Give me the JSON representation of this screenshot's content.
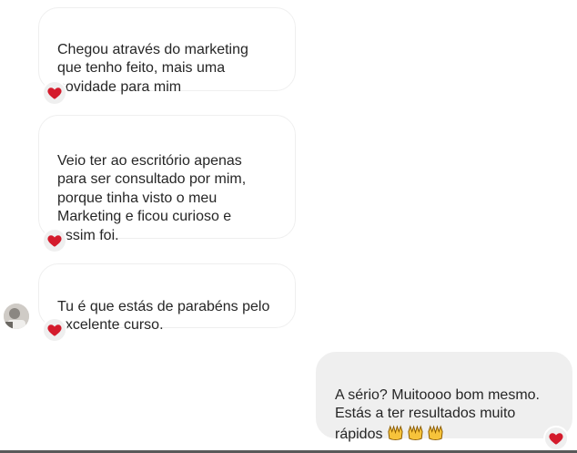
{
  "messages": [
    {
      "direction": "incoming",
      "text": "Chegou através do marketing\nque tenho feito, mais uma\nnovidade para mim",
      "reaction": "heart-icon"
    },
    {
      "direction": "incoming",
      "text": "Veio ter ao escritório apenas\npara ser consultado por mim,\nporque tinha visto o meu\nMarketing e ficou curioso e\nassim foi.",
      "reaction": "heart-icon"
    },
    {
      "direction": "incoming",
      "text": "Tu é que estás de parabéns pelo\nexcelente curso.",
      "reaction": "heart-icon"
    },
    {
      "direction": "outgoing",
      "text": "A sério? Muitoooo bom mesmo.\nEstás a ter resultados muito\nrápidos ",
      "emojis": [
        "🙌",
        "🙌",
        "🙌"
      ],
      "reaction": "heart-icon"
    }
  ],
  "colors": {
    "heart": "#d41b2c",
    "outgoing_bubble": "#efefef",
    "incoming_border": "#efefef",
    "text": "#262626"
  }
}
